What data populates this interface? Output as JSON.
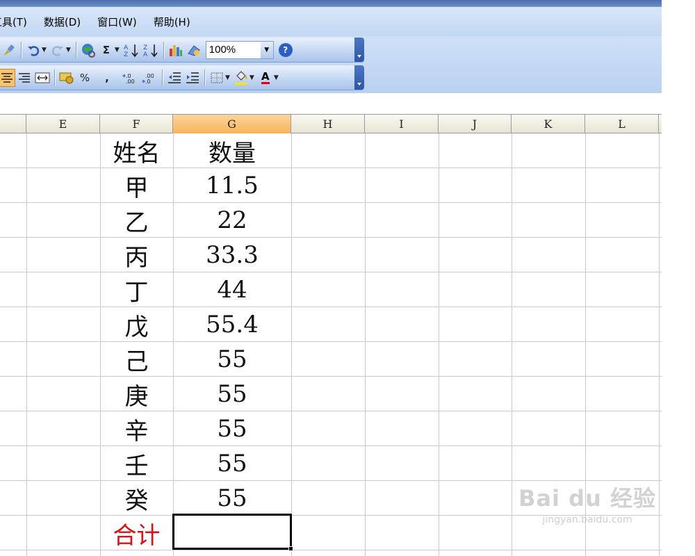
{
  "menu": [
    "工具(T)",
    "数据(D)",
    "窗口(W)",
    "帮助(H)"
  ],
  "toolbar1": {
    "zoom": "100%",
    "icons": [
      "brush-icon",
      "undo-icon",
      "redo-icon",
      "hyperlink-icon",
      "autosum-icon",
      "sort-ascending-icon",
      "sort-descending-icon",
      "chart-wizard-icon",
      "drawing-icon",
      "help-icon"
    ],
    "sigma_glyph": "Σ",
    "help_glyph": "?"
  },
  "toolbar2": {
    "percent": "%",
    "comma": ",",
    "font_color_glyph": "A",
    "icons": [
      "align-center-icon",
      "align-right-icon",
      "merge-center-icon",
      "currency-icon",
      "percent-icon",
      "comma-icon",
      "increase-decimal-icon",
      "decrease-decimal-icon",
      "decrease-indent-icon",
      "increase-indent-icon",
      "borders-icon",
      "fill-color-icon",
      "font-color-icon"
    ]
  },
  "columns": [
    "E",
    "F",
    "G",
    "H",
    "I",
    "J",
    "K",
    "L"
  ],
  "selected_column": "G",
  "sheet": {
    "header": {
      "name": "姓名",
      "qty": "数量"
    },
    "rows": [
      {
        "name": "甲",
        "qty": "11.5"
      },
      {
        "name": "乙",
        "qty": "22"
      },
      {
        "name": "丙",
        "qty": "33.3"
      },
      {
        "name": "丁",
        "qty": "44"
      },
      {
        "name": "戊",
        "qty": "55.4"
      },
      {
        "name": "己",
        "qty": "55"
      },
      {
        "name": "庚",
        "qty": "55"
      },
      {
        "name": "辛",
        "qty": "55"
      },
      {
        "name": "壬",
        "qty": "55"
      },
      {
        "name": "癸",
        "qty": "55"
      }
    ],
    "total_label": "合计",
    "total_value": ""
  },
  "watermark": {
    "brand": "Bai du 经验",
    "url": "jingyan.baidu.com"
  },
  "colors": {
    "total_label": "#e01010",
    "selected_header": "#f7b45c",
    "active_alignment": "#f8c56a"
  }
}
